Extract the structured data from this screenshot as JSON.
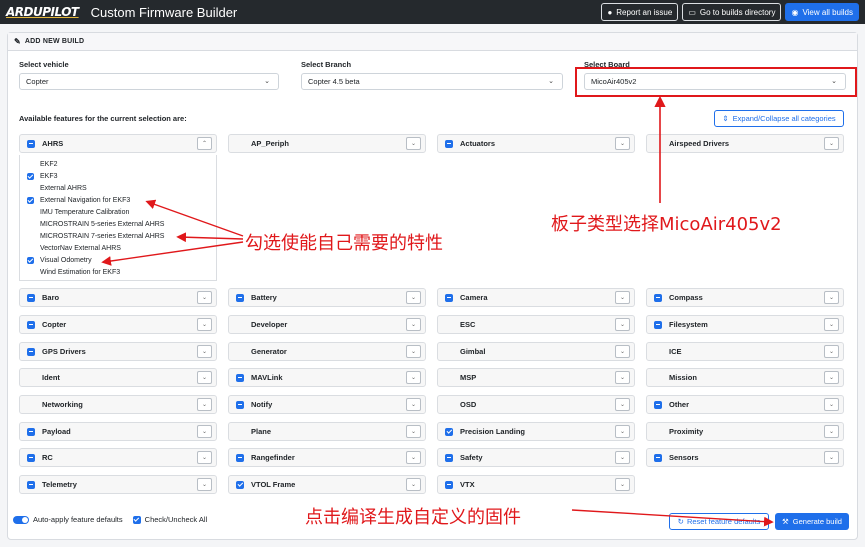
{
  "nav": {
    "logo": "ARDUPILOT",
    "title": "Custom Firmware Builder",
    "report_label": "Report an issue",
    "builds_dir_label": "Go to builds directory",
    "view_builds_label": "View all builds"
  },
  "form": {
    "header": "ADD NEW BUILD",
    "vehicle_label": "Select vehicle",
    "vehicle_value": "Copter",
    "branch_label": "Select Branch",
    "branch_value": "Copter 4.5 beta",
    "board_label": "Select Board",
    "board_value": "MicoAir405v2",
    "features_title": "Available features for the current selection are:",
    "expand_label": "Expand/Collapse all categories"
  },
  "categories": [
    {
      "name": "AHRS",
      "state": "ind"
    },
    {
      "name": "AP_Periph",
      "state": "hid"
    },
    {
      "name": "Actuators",
      "state": "ind"
    },
    {
      "name": "Airspeed Drivers",
      "state": "hid"
    },
    {
      "name": "Baro",
      "state": "ind"
    },
    {
      "name": "Battery",
      "state": "ind"
    },
    {
      "name": "Camera",
      "state": "ind"
    },
    {
      "name": "Compass",
      "state": "ind"
    },
    {
      "name": "Copter",
      "state": "ind"
    },
    {
      "name": "Developer",
      "state": "hid"
    },
    {
      "name": "ESC",
      "state": "hid"
    },
    {
      "name": "Filesystem",
      "state": "ind"
    },
    {
      "name": "GPS Drivers",
      "state": "ind"
    },
    {
      "name": "Generator",
      "state": "hid"
    },
    {
      "name": "Gimbal",
      "state": "hid"
    },
    {
      "name": "ICE",
      "state": "hid"
    },
    {
      "name": "Ident",
      "state": "hid"
    },
    {
      "name": "MAVLink",
      "state": "ind"
    },
    {
      "name": "MSP",
      "state": "hid"
    },
    {
      "name": "Mission",
      "state": "hid"
    },
    {
      "name": "Networking",
      "state": "hid"
    },
    {
      "name": "Notify",
      "state": "ind"
    },
    {
      "name": "OSD",
      "state": "hid"
    },
    {
      "name": "Other",
      "state": "ind"
    },
    {
      "name": "Payload",
      "state": "ind"
    },
    {
      "name": "Plane",
      "state": "hid"
    },
    {
      "name": "Precision Landing",
      "state": "on"
    },
    {
      "name": "Proximity",
      "state": "hid"
    },
    {
      "name": "RC",
      "state": "ind"
    },
    {
      "name": "Rangefinder",
      "state": "ind"
    },
    {
      "name": "Safety",
      "state": "ind"
    },
    {
      "name": "Sensors",
      "state": "ind"
    },
    {
      "name": "Telemetry",
      "state": "ind"
    },
    {
      "name": "VTOL Frame",
      "state": "on"
    },
    {
      "name": "VTX",
      "state": "ind"
    }
  ],
  "ahrs_features": [
    {
      "label": "EKF2",
      "checked": false
    },
    {
      "label": "EKF3",
      "checked": true
    },
    {
      "label": "External AHRS",
      "checked": false
    },
    {
      "label": "External Navigation for EKF3",
      "checked": true
    },
    {
      "label": "IMU Temperature Calibration",
      "checked": false
    },
    {
      "label": "MICROSTRAIN 5-series External AHRS",
      "checked": false
    },
    {
      "label": "MICROSTRAIN 7-series External AHRS",
      "checked": false
    },
    {
      "label": "VectorNav External AHRS",
      "checked": false
    },
    {
      "label": "Visual Odometry",
      "checked": true
    },
    {
      "label": "Wind Estimation for EKF3",
      "checked": false
    }
  ],
  "footer": {
    "auto_apply_label": "Auto-apply feature defaults",
    "check_all_label": "Check/Uncheck All",
    "reset_label": "Reset feature defaults",
    "generate_label": "Generate build"
  },
  "annotations": {
    "features_note": "勾选使能自己需要的特性",
    "board_note": "板子类型选择MicoAir405v2",
    "build_note": "点击编译生成自定义的固件"
  },
  "colors": {
    "accent": "#1f6fea",
    "annotation": "#e0181b",
    "navbar": "#25292d"
  }
}
